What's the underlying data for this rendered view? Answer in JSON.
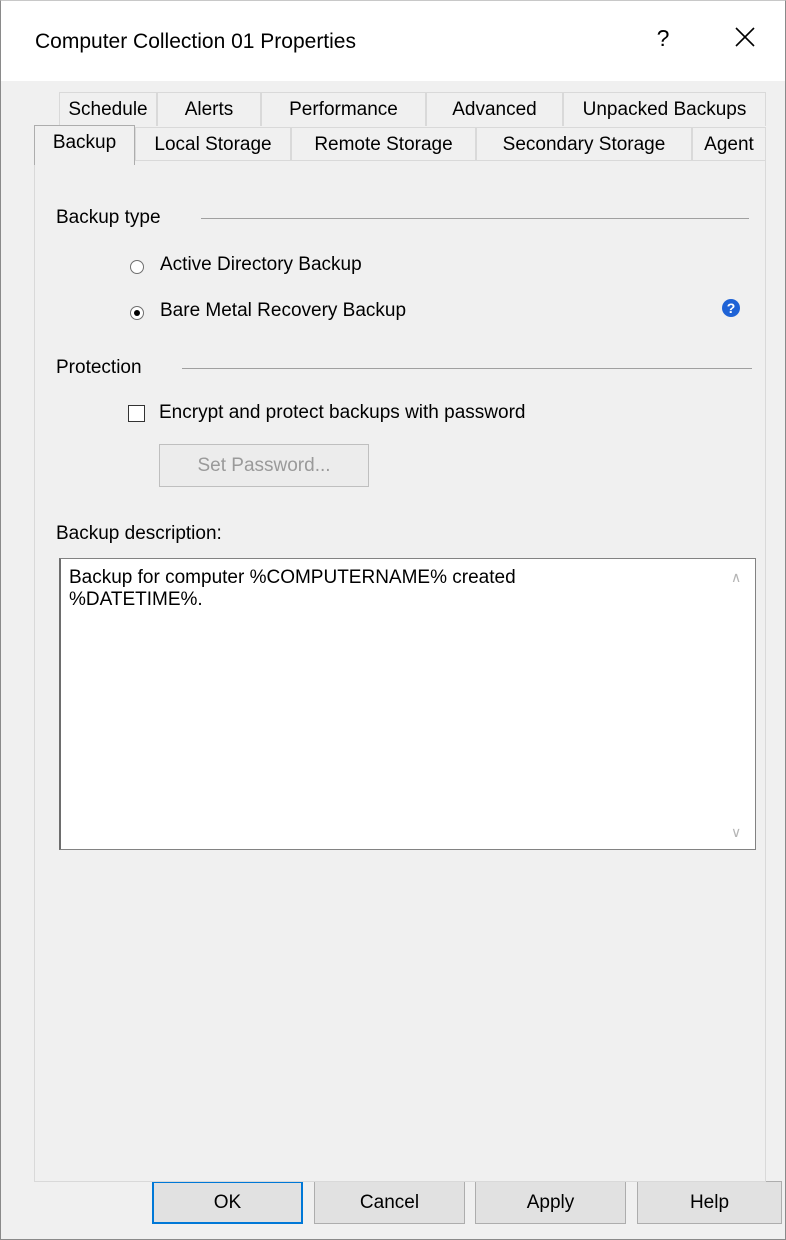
{
  "window": {
    "title": "Computer Collection 01 Properties",
    "help_glyph": "?",
    "close_icon": "close-icon"
  },
  "tabs": {
    "row1": [
      "Schedule",
      "Alerts",
      "Performance",
      "Advanced",
      "Unpacked Backups"
    ],
    "row2": [
      "Backup",
      "Local Storage",
      "Remote Storage",
      "Secondary Storage",
      "Agent"
    ],
    "active": "Backup"
  },
  "backup_type": {
    "label": "Backup type",
    "options": [
      "Active Directory Backup",
      "Bare Metal Recovery Backup"
    ],
    "selected": "Bare Metal Recovery Backup",
    "help_icon": "question-icon",
    "help_glyph": "?"
  },
  "protection": {
    "label": "Protection",
    "encrypt_label": "Encrypt and protect backups with password",
    "encrypt_checked": false,
    "set_password_label": "Set Password..."
  },
  "description": {
    "label": "Backup description:",
    "value": "Backup for computer %COMPUTERNAME% created\n%DATETIME%."
  },
  "buttons": {
    "ok": "OK",
    "cancel": "Cancel",
    "apply": "Apply",
    "help": "Help"
  },
  "colors": {
    "accent": "#0078d7",
    "help_icon": "#1f63d6",
    "dialog_bg": "#f0f0f0"
  }
}
